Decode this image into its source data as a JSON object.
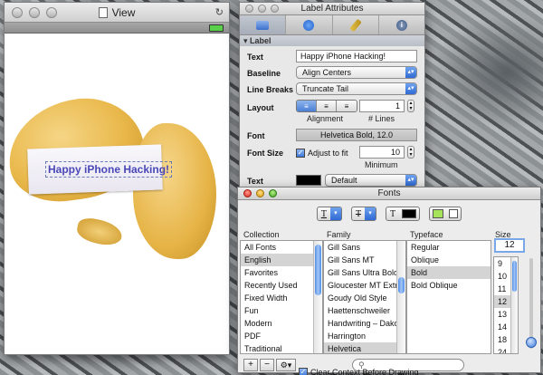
{
  "view_window": {
    "title": "View",
    "label_text": "Happy iPhone Hacking!"
  },
  "inspector": {
    "title": "Label Attributes",
    "section": "Label",
    "text_label": "Text",
    "text_value": "Happy iPhone Hacking!",
    "baseline_label": "Baseline",
    "baseline_value": "Align Centers",
    "line_breaks_label": "Line Breaks",
    "line_breaks_value": "Truncate Tail",
    "layout_label": "Layout",
    "alignment_caption": "Alignment",
    "lines_value": "1",
    "lines_caption": "# Lines",
    "font_label": "Font",
    "font_value": "Helvetica Bold, 12.0",
    "font_size_label": "Font Size",
    "adjust_label": "Adjust to fit",
    "minimum_value": "10",
    "minimum_caption": "Minimum",
    "text_color_label": "Text",
    "text_color_value": "Default",
    "text_color_hex": "#000000",
    "clear_context_label": "Clear Context Before Drawing"
  },
  "fonts": {
    "title": "Fonts",
    "columns": {
      "collection": "Collection",
      "family": "Family",
      "typeface": "Typeface",
      "size": "Size"
    },
    "collections": [
      "All Fonts",
      "English",
      "Favorites",
      "Recently Used",
      "Fixed Width",
      "Fun",
      "Modern",
      "PDF",
      "Traditional"
    ],
    "collection_selected": 1,
    "families": [
      "Gill Sans",
      "Gill Sans MT",
      "Gill Sans Ultra Bold",
      "Gloucester MT Extra",
      "Goudy Old Style",
      "Haettenschweiler",
      "Handwriting – Dakota",
      "Harrington",
      "Helvetica"
    ],
    "family_selected": 8,
    "typefaces": [
      "Regular",
      "Oblique",
      "Bold",
      "Bold Oblique"
    ],
    "typeface_selected": 2,
    "size_value": "12",
    "sizes": [
      "9",
      "10",
      "11",
      "12",
      "13",
      "14",
      "18",
      "24"
    ],
    "size_selected": 3,
    "text_color_hex": "#000000",
    "document_color_hex": "#a6e35a"
  },
  "colors": {
    "accent": "#3f7fe0",
    "selection": "#d4d4d4"
  }
}
